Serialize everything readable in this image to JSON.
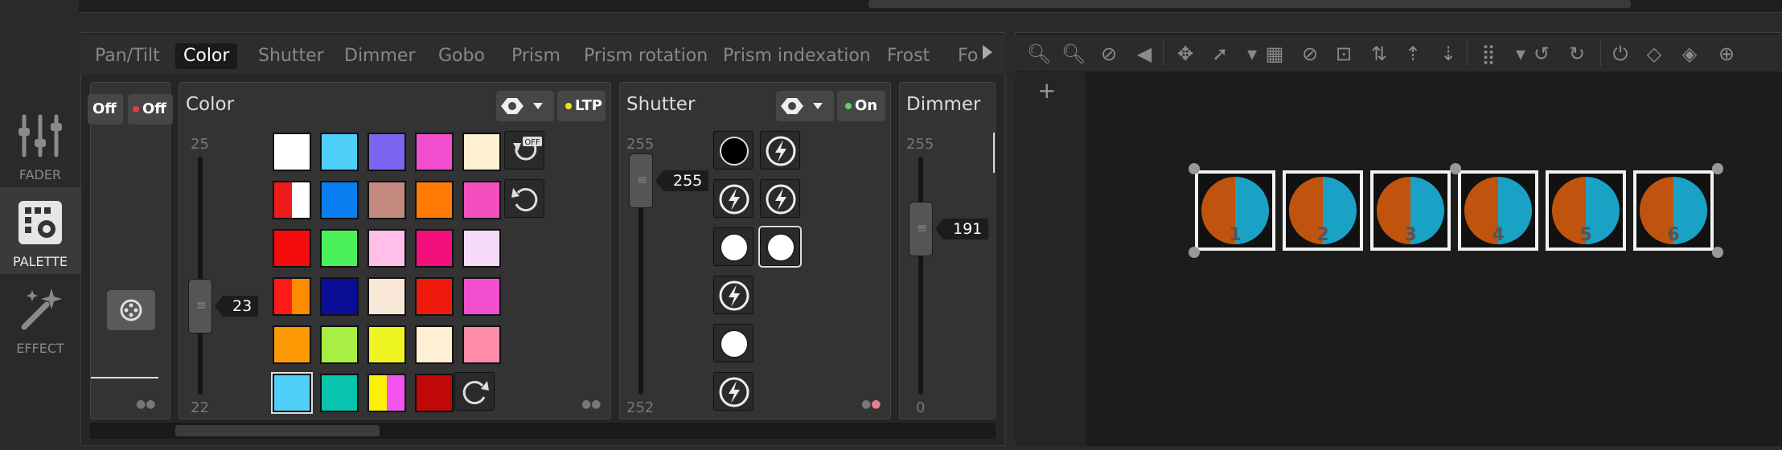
{
  "nav": [
    {
      "label": "FADER",
      "icon": "fader-icon"
    },
    {
      "label": "PALETTE",
      "icon": "palette-icon",
      "active": true
    },
    {
      "label": "EFFECT",
      "icon": "effect-wand-icon"
    }
  ],
  "tabs": [
    "Pan/Tilt",
    "Color",
    "Shutter",
    "Dimmer",
    "Gobo",
    "Prism",
    "Prism rotation",
    "Prism indexation",
    "Frost",
    "Fo"
  ],
  "active_tab": "Color",
  "partial_card": {
    "off1": "Off",
    "off2": "Off"
  },
  "color_card": {
    "title": "Color",
    "mode_label": "LTP",
    "range_top": "25",
    "range_bottom": "22",
    "slider_value": "23",
    "swatch_rows": [
      [
        "#ffffff",
        "#4fd0f8",
        "#7a66f0",
        "#f24fce",
        "#fff0cf"
      ],
      [
        "split:#ef1a1a:#ffffff",
        "#0a7eef",
        "#c48a80",
        "#ff7b06",
        "#f44fbf"
      ],
      [
        "#f40c0c",
        "#4cf05a",
        "#ffbfe8",
        "#f3107c",
        "#f6dcf8"
      ],
      [
        "split:#ff1a1a:#ff8b00",
        "#0b0d96",
        "#f9e8d8",
        "#ef1a0c",
        "#f24fce"
      ],
      [
        "#fe9a05",
        "#a8ef44",
        "#eef422",
        "#fff0d4",
        "#ff8ca8"
      ],
      [
        "#4fd0f8",
        "#06c4ad",
        "split:#fbf107:#f455f0",
        "#c00808"
      ]
    ],
    "selected_swatch": "5,0"
  },
  "shutter_card": {
    "title": "Shutter",
    "mode_label": "On",
    "range_top": "255",
    "range_bottom": "252",
    "slider_value": "255"
  },
  "dimmer_card": {
    "title": "Dimmer",
    "range_top": "255",
    "range_bottom": "0",
    "slider_value": "191"
  },
  "fixtures": [
    "1",
    "2",
    "3",
    "4",
    "5",
    "6"
  ],
  "colors": {
    "fixture_left": "#c0540e",
    "fixture_right": "#1aa2c6",
    "ltp_dot": "#f0e020",
    "on_dot": "#60d060",
    "off_dot": "#e04040"
  }
}
